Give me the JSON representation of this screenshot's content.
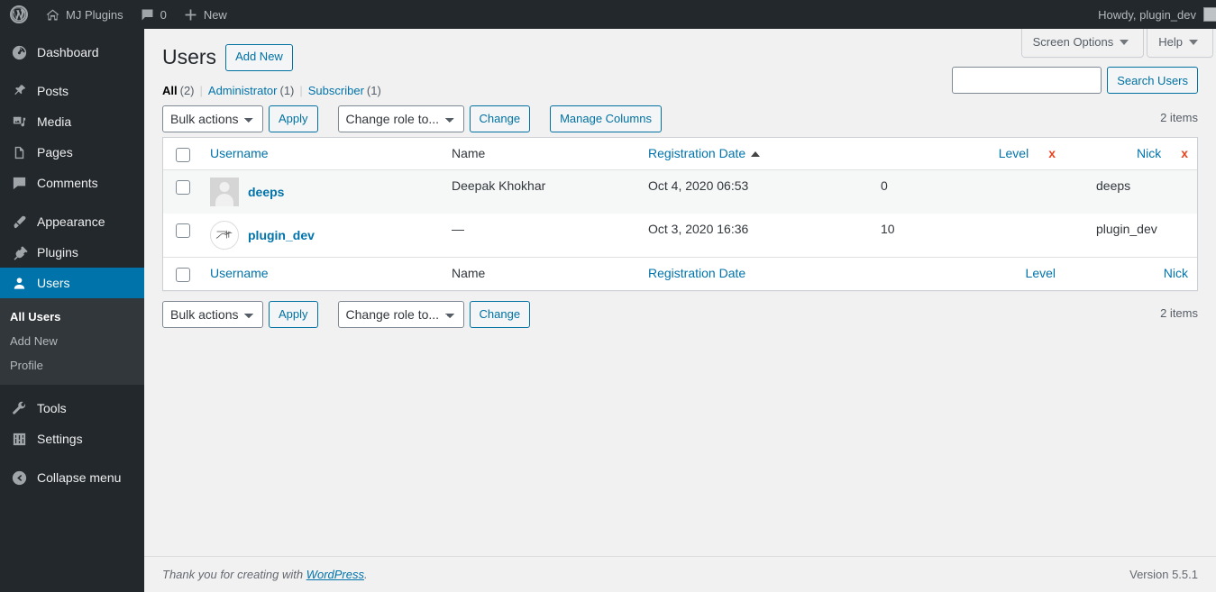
{
  "adminbar": {
    "logo_icon": "wordpress-logo-icon",
    "site_icon": "home-icon",
    "site_name": "MJ Plugins",
    "comments_icon": "comment-bubble-icon",
    "comments_count": "0",
    "new_icon": "plus-icon",
    "new_label": "New",
    "howdy": "Howdy, plugin_dev",
    "avatar_name": "user-avatar"
  },
  "sidebar": {
    "items": [
      {
        "label": "Dashboard",
        "icon": "dashboard-icon",
        "name": "dashboard",
        "current": false
      },
      {
        "label": "Posts",
        "icon": "pin-icon",
        "name": "posts",
        "current": false
      },
      {
        "label": "Media",
        "icon": "media-icon",
        "name": "media",
        "current": false
      },
      {
        "label": "Pages",
        "icon": "pages-icon",
        "name": "pages",
        "current": false
      },
      {
        "label": "Comments",
        "icon": "comment-bubble-icon",
        "name": "comments",
        "current": false
      },
      {
        "label": "Appearance",
        "icon": "paintbrush-icon",
        "name": "appearance",
        "current": false
      },
      {
        "label": "Plugins",
        "icon": "plug-icon",
        "name": "plugins",
        "current": false
      },
      {
        "label": "Users",
        "icon": "user-icon",
        "name": "users",
        "current": true
      },
      {
        "label": "Tools",
        "icon": "wrench-icon",
        "name": "tools",
        "current": false
      },
      {
        "label": "Settings",
        "icon": "sliders-icon",
        "name": "settings",
        "current": false
      },
      {
        "label": "Collapse menu",
        "icon": "collapse-arrow-icon",
        "name": "collapse-menu",
        "current": false
      }
    ],
    "submenu": [
      {
        "label": "All Users",
        "current": true
      },
      {
        "label": "Add New",
        "current": false
      },
      {
        "label": "Profile",
        "current": false
      }
    ],
    "highlight_color": "#0073aa"
  },
  "screen_meta": {
    "screen_options_label": "Screen Options",
    "help_label": "Help"
  },
  "page": {
    "title": "Users",
    "add_new_label": "Add New"
  },
  "views": [
    {
      "label": "All",
      "count": "(2)",
      "current": true
    },
    {
      "label": "Administrator",
      "count": "(1)",
      "current": false
    },
    {
      "label": "Subscriber",
      "count": "(1)",
      "current": false
    }
  ],
  "search": {
    "value": "",
    "placeholder": "",
    "button_label": "Search Users"
  },
  "tablenav_top": {
    "bulk_actions_label": "Bulk actions",
    "apply_label": "Apply",
    "change_role_label": "Change role to...",
    "change_label": "Change",
    "manage_columns_label": "Manage Columns",
    "displaying_num": "2 items"
  },
  "tablenav_bottom": {
    "bulk_actions_label": "Bulk actions",
    "apply_label": "Apply",
    "change_role_label": "Change role to...",
    "change_label": "Change",
    "displaying_num": "2 items"
  },
  "table": {
    "columns": {
      "username": "Username",
      "name": "Name",
      "regdate": "Registration Date",
      "level": "Level",
      "nick": "Nick"
    },
    "sorted_column": "regdate",
    "sort_direction": "asc",
    "removable_columns": [
      "level",
      "nick"
    ],
    "remove_glyph": "x",
    "remove_color": "#e8431f",
    "rows": [
      {
        "username": "deeps",
        "avatar": "mystery-person-avatar",
        "name": "Deepak Khokhar",
        "regdate": "Oct 4, 2020 06:53",
        "level": "0",
        "nick": "deeps"
      },
      {
        "username": "plugin_dev",
        "avatar": "signature-avatar",
        "name": "—",
        "regdate": "Oct 3, 2020 16:36",
        "level": "10",
        "nick": "plugin_dev"
      }
    ]
  },
  "footer": {
    "thanks_prefix": "Thank you for creating with ",
    "wordpress_link": "WordPress",
    "thanks_suffix": ".",
    "version": "Version 5.5.1"
  }
}
